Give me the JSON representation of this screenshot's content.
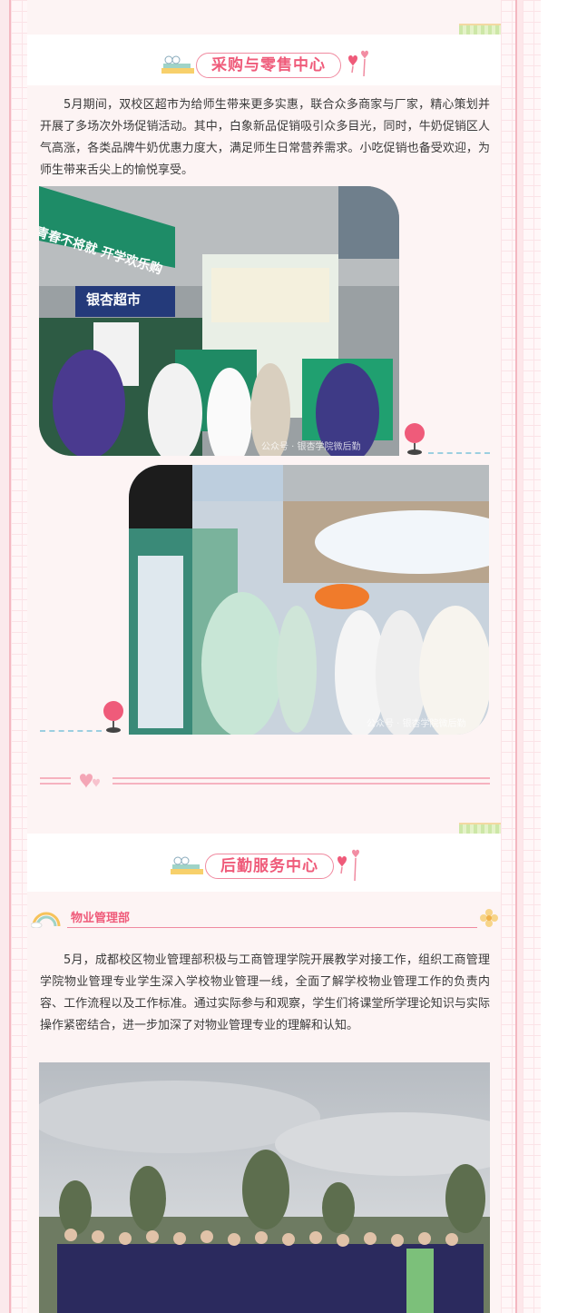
{
  "colors": {
    "accent": "#ef5b7a",
    "panel": "#fdf4f4",
    "border": "#f4b7c1"
  },
  "section1": {
    "title": "采购与零售中心",
    "paragraph": "5月期间，双校区超市为给师生带来更多实惠，联合众多商家与厂家，精心策划并开展了多场次外场促销活动。其中，白象新品促销吸引众多目光，同时，牛奶促销区人气高涨，各类品牌牛奶优惠力度大，满足师生日常营养需求。小吃促销也备受欢迎，为师生带来舌尖上的愉悦享受。",
    "photo1": {
      "banner": "青春不将就 开学欢乐购",
      "store_sign": "银杏超市",
      "watermark": "公众号 · 银杏学院微后勤"
    },
    "photo2": {
      "watermark": "公众号 · 银杏学院微后勤"
    }
  },
  "section2": {
    "title": "后勤服务中心",
    "subsection": "物业管理部",
    "paragraph": "5月，成都校区物业管理部积极与工商管理学院开展教学对接工作，组织工商管理学院物业管理专业学生深入学校物业管理一线，全面了解学校物业管理工作的负责内容、工作流程以及工作标准。通过实际参与和观察，学生们将课堂所学理论知识与实际操作紧密结合，进一步加深了对物业管理专业的理解和认知。"
  },
  "icons": [
    "books-icon",
    "heart-pin-icon",
    "map-pin-icon",
    "double-heart-icon",
    "rainbow-icon",
    "flower-icon",
    "tape-icon"
  ]
}
